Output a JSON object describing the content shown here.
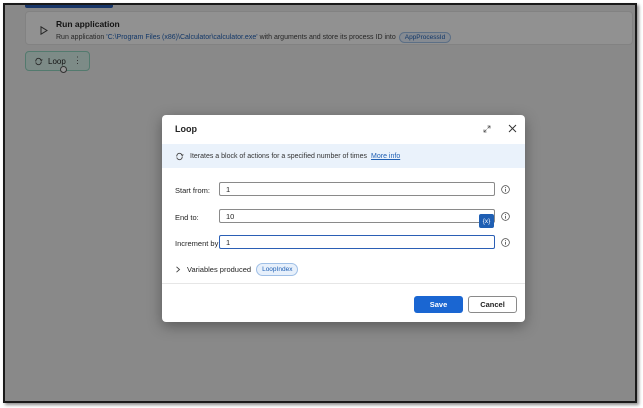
{
  "background": {
    "action": {
      "title": "Run application",
      "desc_prefix": "Run application",
      "path": "'C:\\Program Files (x86)\\Calculator\\calculator.exe'",
      "desc_middle": "with arguments  and store its process ID into",
      "variable": "AppProcessId"
    },
    "loop_chip": {
      "label": "Loop",
      "menu": "⋮"
    }
  },
  "dialog": {
    "title": "Loop",
    "info": {
      "text": "Iterates a block of actions for a specified number of times",
      "link": "More info"
    },
    "fields": [
      {
        "label": "Start from:",
        "value": "1"
      },
      {
        "label": "End to:",
        "value": "10"
      },
      {
        "label": "Increment by:",
        "value": "1"
      }
    ],
    "variable_button": "{x}",
    "variables_produced": {
      "label": "Variables produced",
      "variable": "LoopIndex"
    },
    "buttons": {
      "save": "Save",
      "cancel": "Cancel"
    }
  },
  "colors": {
    "accent": "#1a66d2",
    "link": "#1f5fb3",
    "chip_bg": "#d8f0e8"
  }
}
